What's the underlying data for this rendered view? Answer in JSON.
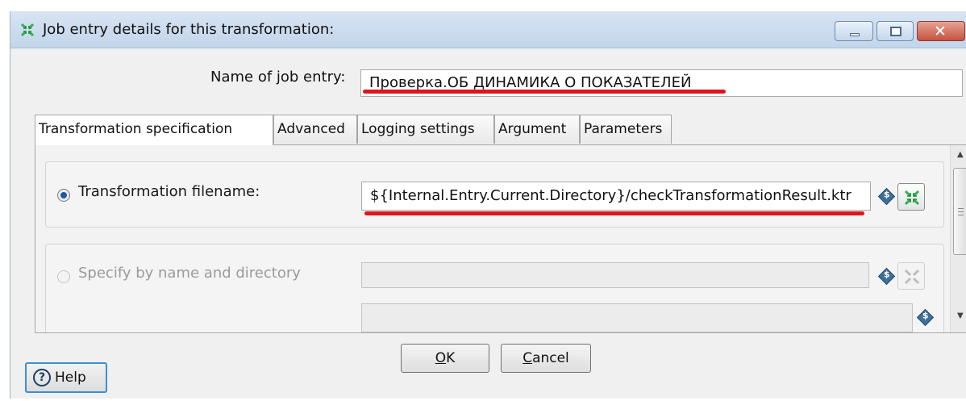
{
  "window": {
    "title": "Job entry details for this transformation:",
    "icon": "spoon-transformation-icon"
  },
  "form": {
    "name_label": "Name of job entry:",
    "name_value": "Проверка.ОБ ДИНАМИКА О ПОКАЗАТЕЛЕЙ"
  },
  "tabs": [
    {
      "label": "Transformation specification",
      "active": true
    },
    {
      "label": "Advanced",
      "active": false
    },
    {
      "label": "Logging settings",
      "active": false
    },
    {
      "label": "Argument",
      "active": false
    },
    {
      "label": "Parameters",
      "active": false
    }
  ],
  "spec": {
    "option_filename_label": "Transformation filename:",
    "option_filename_selected": true,
    "filename_value": "${Internal.Entry.Current.Directory}/checkTransformationResult.ktr",
    "option_name_dir_label": "Specify by name and directory",
    "option_name_dir_selected": false,
    "variable_icon": "variable-diamond-icon"
  },
  "buttons": {
    "ok_mnemonic": "O",
    "ok_rest": "K",
    "cancel_mnemonic": "C",
    "cancel_rest": "ancel",
    "help": "Help"
  },
  "colors": {
    "annotation_red": "#e0151b",
    "titlebar": "#c3d5ea",
    "focus_blue": "#3d8fd1"
  }
}
